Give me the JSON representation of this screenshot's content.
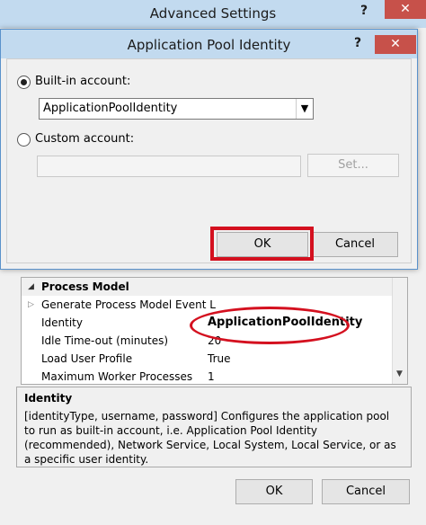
{
  "outer": {
    "title": "Advanced Settings",
    "help": "?",
    "close": "✕",
    "grid": {
      "category": "Process Model",
      "rows": [
        {
          "label": "Generate Process Model Event L",
          "value": ""
        },
        {
          "label": "Identity",
          "value": "ApplicationPoolIdentity"
        },
        {
          "label": "Idle Time-out (minutes)",
          "value": "20"
        },
        {
          "label": "Load User Profile",
          "value": "True"
        },
        {
          "label": "Maximum Worker Processes",
          "value": "1"
        }
      ]
    },
    "description": {
      "title": "Identity",
      "text": "[identityType, username, password] Configures the application pool to run as built-in account, i.e. Application Pool Identity (recommended), Network Service, Local System, Local Service, or as a specific user identity."
    },
    "ok": "OK",
    "cancel": "Cancel"
  },
  "dialog": {
    "title": "Application Pool Identity",
    "help": "?",
    "close": "✕",
    "builtin_label": "Built-in account:",
    "builtin_value": "ApplicationPoolIdentity",
    "custom_label": "Custom account:",
    "set_label": "Set...",
    "ok": "OK",
    "cancel": "Cancel"
  },
  "colors": {
    "highlight": "#d4101f",
    "titlebar": "#c2daef",
    "close": "#c7514a"
  }
}
